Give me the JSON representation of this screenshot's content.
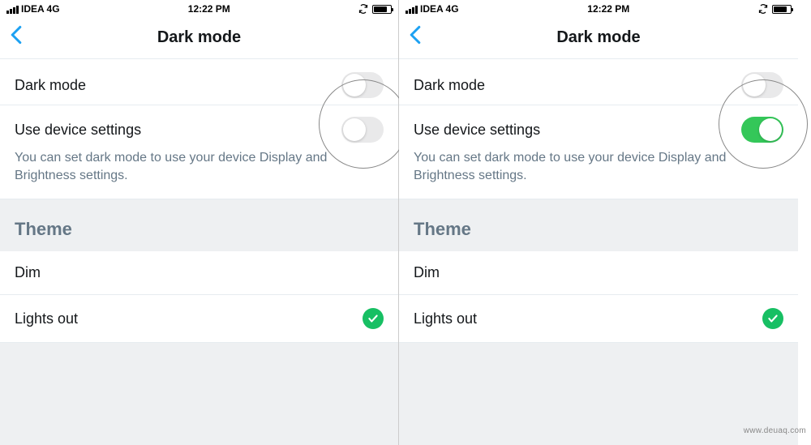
{
  "status_bar": {
    "carrier": "IDEA 4G",
    "time": "12:22 PM"
  },
  "header": {
    "title": "Dark mode"
  },
  "rows": {
    "dark_mode_label": "Dark mode",
    "use_device_label": "Use device settings",
    "use_device_subtext": "You can set dark mode to use your device Display and Brightness settings."
  },
  "theme": {
    "section_title": "Theme",
    "dim": "Dim",
    "lights_out": "Lights out"
  },
  "watermark": "www.deuaq.com"
}
